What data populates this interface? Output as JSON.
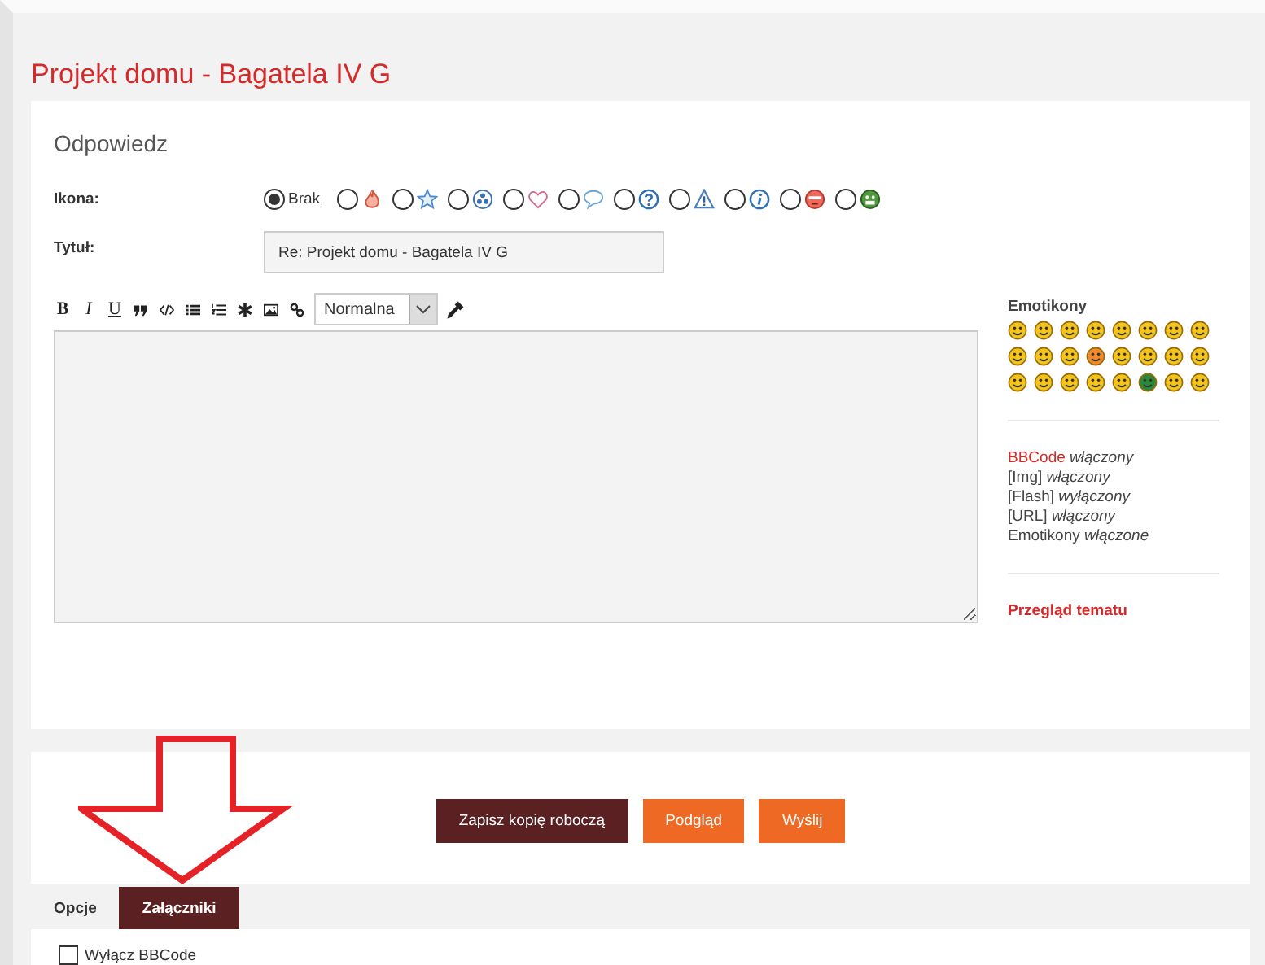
{
  "page_title": "Projekt domu - Bagatela IV G",
  "reply": {
    "heading": "Odpowiedz",
    "icon_label": "Ikona:",
    "icon_options": [
      {
        "kind": "none",
        "label": "Brak",
        "selected": true
      },
      {
        "kind": "fire",
        "selected": false
      },
      {
        "kind": "star",
        "selected": false
      },
      {
        "kind": "radioactive",
        "selected": false
      },
      {
        "kind": "heart",
        "selected": false
      },
      {
        "kind": "speech",
        "selected": false
      },
      {
        "kind": "question",
        "selected": false
      },
      {
        "kind": "warning",
        "selected": false
      },
      {
        "kind": "info",
        "selected": false
      },
      {
        "kind": "red-face",
        "selected": false
      },
      {
        "kind": "green-face",
        "selected": false
      }
    ],
    "title_label": "Tytuł:",
    "title_value": "Re: Projekt domu - Bagatela IV G",
    "toolbar": [
      {
        "kind": "bold",
        "label": "B"
      },
      {
        "kind": "italic",
        "label": "I"
      },
      {
        "kind": "underline",
        "label": "U"
      },
      {
        "kind": "quote"
      },
      {
        "kind": "code"
      },
      {
        "kind": "list"
      },
      {
        "kind": "olist"
      },
      {
        "kind": "star"
      },
      {
        "kind": "image"
      },
      {
        "kind": "link"
      }
    ],
    "font_size": "Normalna",
    "emoticons_heading": "Emotikony",
    "features": [
      {
        "link": "BBCode",
        "text": " *włączony*"
      },
      {
        "text": "[Img] *włączony*"
      },
      {
        "text": "[Flash] *wyłączony*"
      },
      {
        "text": "[URL] *włączony*"
      },
      {
        "text": "Emotikony *włączone*"
      }
    ],
    "review_link": "Przegląd tematu"
  },
  "actions": [
    {
      "kind": "dark",
      "label": "Zapisz kopię roboczą"
    },
    {
      "kind": "orange",
      "label": "Podgląd"
    },
    {
      "kind": "orange",
      "label": "Wyślij"
    }
  ],
  "tabs": [
    {
      "label": "Opcje",
      "selected": false
    },
    {
      "label": "Załączniki",
      "selected": true
    }
  ],
  "options": [
    {
      "label": "Wyłącz BBCode",
      "checked": false
    }
  ]
}
